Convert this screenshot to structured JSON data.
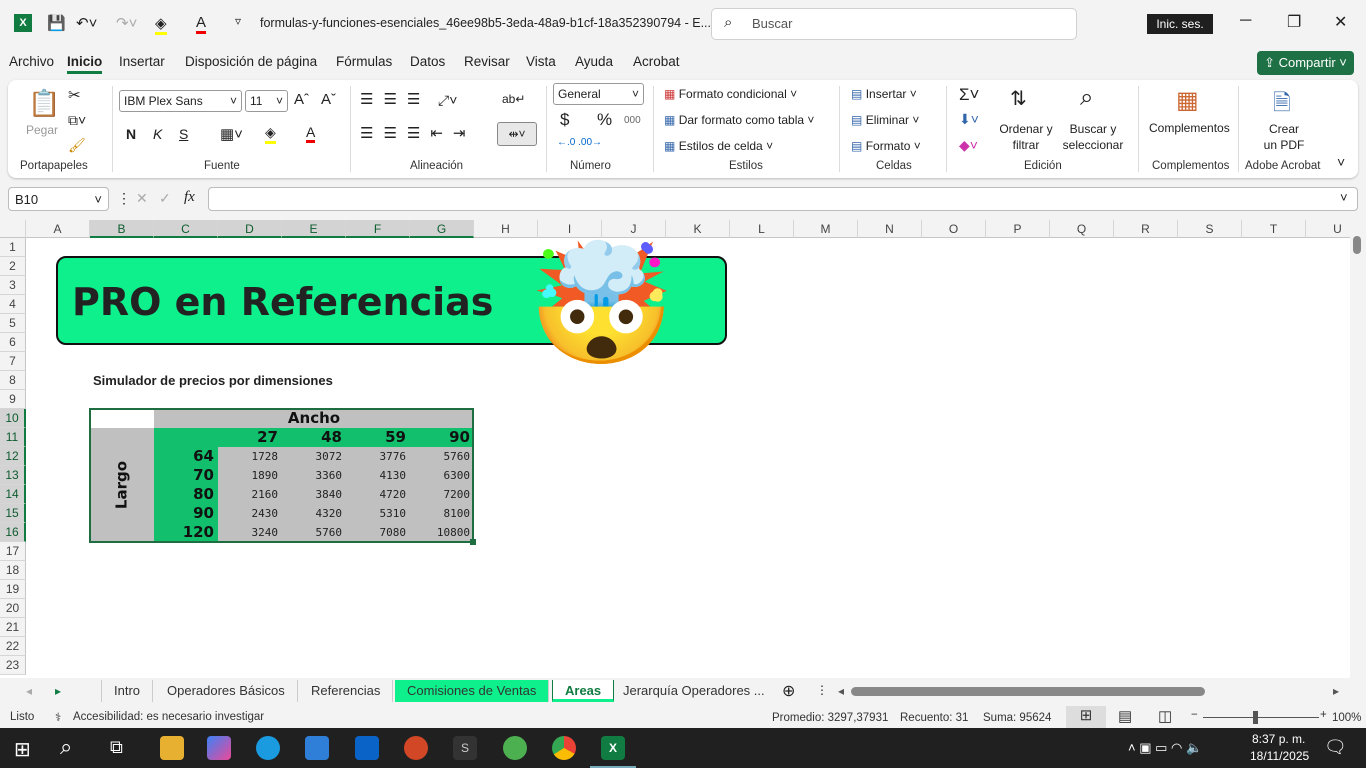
{
  "titlebar": {
    "filename": "formulas-y-funciones-esenciales_46ee98b5-3eda-48a9-b1cf-18a352390794  -  E...",
    "search_placeholder": "Buscar",
    "sign_in": "Inic. ses.",
    "minimize": "─",
    "maximize": "❐",
    "close": "✕"
  },
  "menu": {
    "items": [
      "Archivo",
      "Inicio",
      "Insertar",
      "Disposición de página",
      "Fórmulas",
      "Datos",
      "Revisar",
      "Vista",
      "Ayuda",
      "Acrobat"
    ],
    "active": "Inicio",
    "share": "Compartir"
  },
  "ribbon": {
    "clipboard": {
      "paste": "Pegar",
      "group": "Portapapeles"
    },
    "font": {
      "name": "IBM Plex Sans",
      "size": "11",
      "bold": "N",
      "italic": "K",
      "underline": "S",
      "group": "Fuente"
    },
    "alignment": {
      "group": "Alineación"
    },
    "number": {
      "format": "General",
      "currency": "$",
      "percent": "%",
      "thousands": "000",
      "group": "Número"
    },
    "styles": {
      "conditional": "Formato condicional",
      "table": "Dar formato como tabla",
      "cell_styles": "Estilos de celda",
      "group": "Estilos"
    },
    "cells": {
      "insert": "Insertar",
      "delete": "Eliminar",
      "format": "Formato",
      "group": "Celdas"
    },
    "editing": {
      "sort": "Ordenar y filtrar",
      "find": "Buscar y seleccionar",
      "group": "Edición"
    },
    "addins": {
      "label": "Complementos",
      "group": "Complementos"
    },
    "acrobat": {
      "label": "Crear un PDF",
      "group": "Adobe Acrobat"
    }
  },
  "formula_bar": {
    "name_box": "B10",
    "fx": "fx",
    "value": ""
  },
  "columns": [
    "A",
    "B",
    "C",
    "D",
    "E",
    "F",
    "G",
    "H",
    "I",
    "J",
    "K",
    "L",
    "M",
    "N",
    "O",
    "P",
    "Q",
    "R",
    "S",
    "T",
    "U"
  ],
  "selected_columns": [
    "B",
    "C",
    "D",
    "E",
    "F",
    "G"
  ],
  "rows": [
    1,
    2,
    3,
    4,
    5,
    6,
    7,
    8,
    9,
    10,
    11,
    12,
    13,
    14,
    15,
    16,
    17,
    18,
    19,
    20,
    21,
    22,
    23
  ],
  "selected_rows": [
    10,
    11,
    12,
    13,
    14,
    15,
    16
  ],
  "sheet": {
    "banner_title": "PRO en Referencias",
    "banner_emoji": "🤯",
    "subtitle": "Simulador de precios por dimensiones",
    "ancho_label": "Ancho",
    "largo_label": "Largo",
    "ancho_values": [
      "27",
      "48",
      "59",
      "90"
    ],
    "largo_values": [
      "64",
      "70",
      "80",
      "90",
      "120"
    ],
    "matrix": [
      [
        "1728",
        "3072",
        "3776",
        "5760"
      ],
      [
        "1890",
        "3360",
        "4130",
        "6300"
      ],
      [
        "2160",
        "3840",
        "4720",
        "7200"
      ],
      [
        "2430",
        "4320",
        "5310",
        "8100"
      ],
      [
        "3240",
        "5760",
        "7080",
        "10800"
      ]
    ],
    "colors": {
      "banner": "#0ef08c",
      "header_green": "#12bf6c",
      "gray": "#c0c0c0",
      "selection": "#107c41"
    }
  },
  "sheet_tabs": [
    {
      "label": "Intro"
    },
    {
      "label": "Operadores Básicos"
    },
    {
      "label": "Referencias"
    },
    {
      "label": "Comisiones de Ventas",
      "color": "#0ef08c"
    },
    {
      "label": "Areas",
      "active": true
    },
    {
      "label": "Jerarquía Operadores ..."
    }
  ],
  "status": {
    "ready": "Listo",
    "accessibility": "Accesibilidad: es necesario investigar",
    "average": "Promedio: 3297,37931",
    "count": "Recuento: 31",
    "sum": "Suma: 95624",
    "zoom": "100%",
    "zoom_value": 100
  },
  "taskbar": {
    "time": "8:37 p. m.",
    "date": "18/11/2025"
  }
}
